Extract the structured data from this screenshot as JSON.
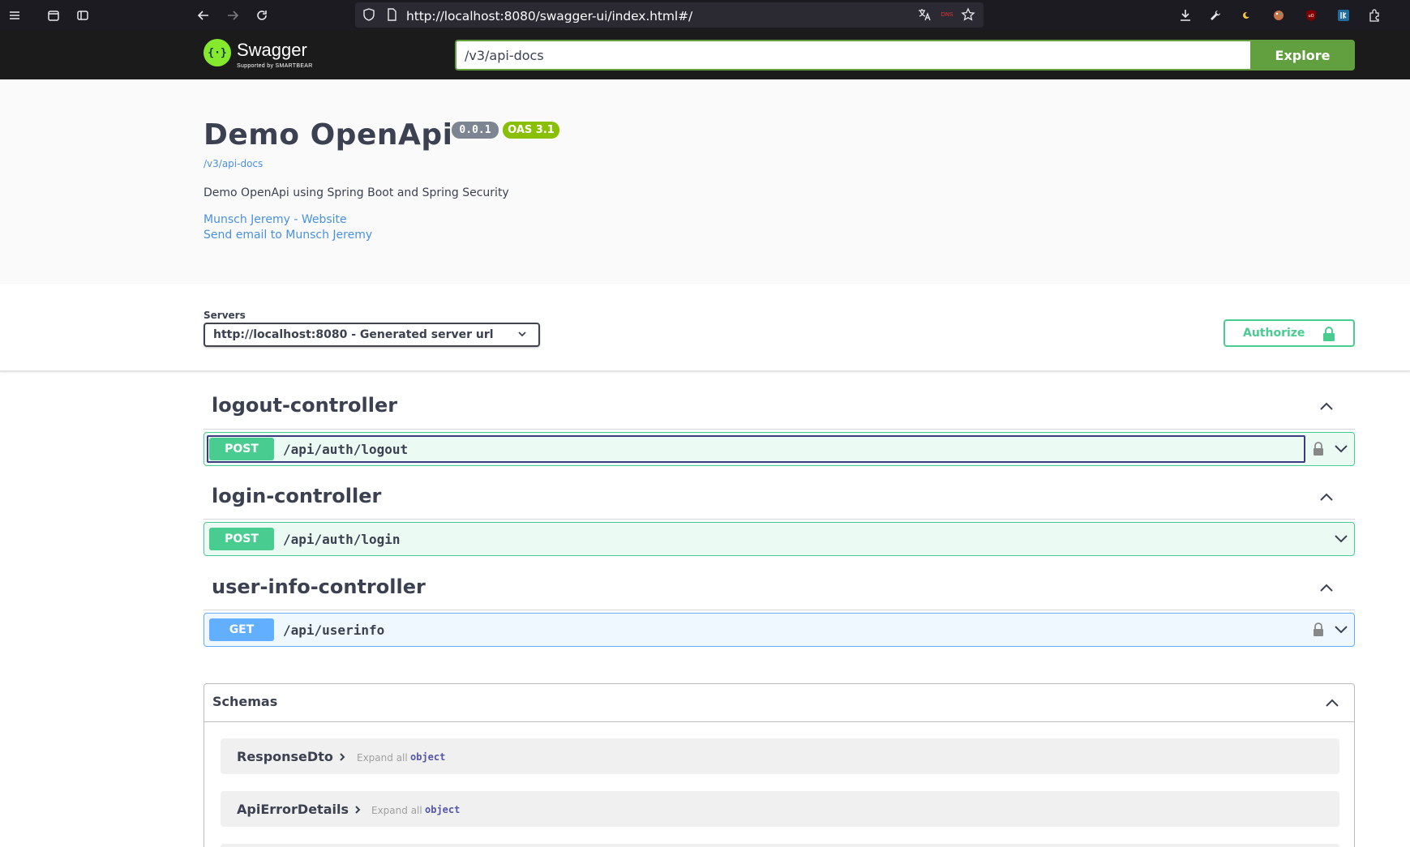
{
  "browser": {
    "url": "http://localhost:8080/swagger-ui/index.html#/"
  },
  "topbar": {
    "logo_text": "Swagger",
    "logo_sub": "Supported by SMARTBEAR",
    "explore_input_value": "/v3/api-docs",
    "explore_label": "Explore"
  },
  "info": {
    "title": "Demo OpenApi",
    "version": "0.0.1",
    "oas": "OAS 3.1",
    "spec_link": "/v3/api-docs",
    "description": "Demo OpenApi using Spring Boot and Spring Security",
    "contact_website": "Munsch Jeremy - Website",
    "contact_email": "Send email to Munsch Jeremy"
  },
  "servers": {
    "label": "Servers",
    "selected": "http://localhost:8080 - Generated server url",
    "authorize_label": "Authorize"
  },
  "controllers": [
    {
      "name": "logout-controller",
      "method": "POST",
      "path": "/api/auth/logout"
    },
    {
      "name": "login-controller",
      "method": "POST",
      "path": "/api/auth/login"
    },
    {
      "name": "user-info-controller",
      "method": "GET",
      "path": "/api/userinfo"
    }
  ],
  "schemas": {
    "title": "Schemas",
    "models": [
      {
        "name": "ResponseDto",
        "expand": "Expand all",
        "type": "object"
      },
      {
        "name": "ApiErrorDetails",
        "expand": "Expand all",
        "type": "object"
      }
    ]
  },
  "colors": {
    "post": "#49cc90",
    "get": "#61affe",
    "swagger_green": "#85ea2d",
    "explore_green": "#62a03f"
  }
}
